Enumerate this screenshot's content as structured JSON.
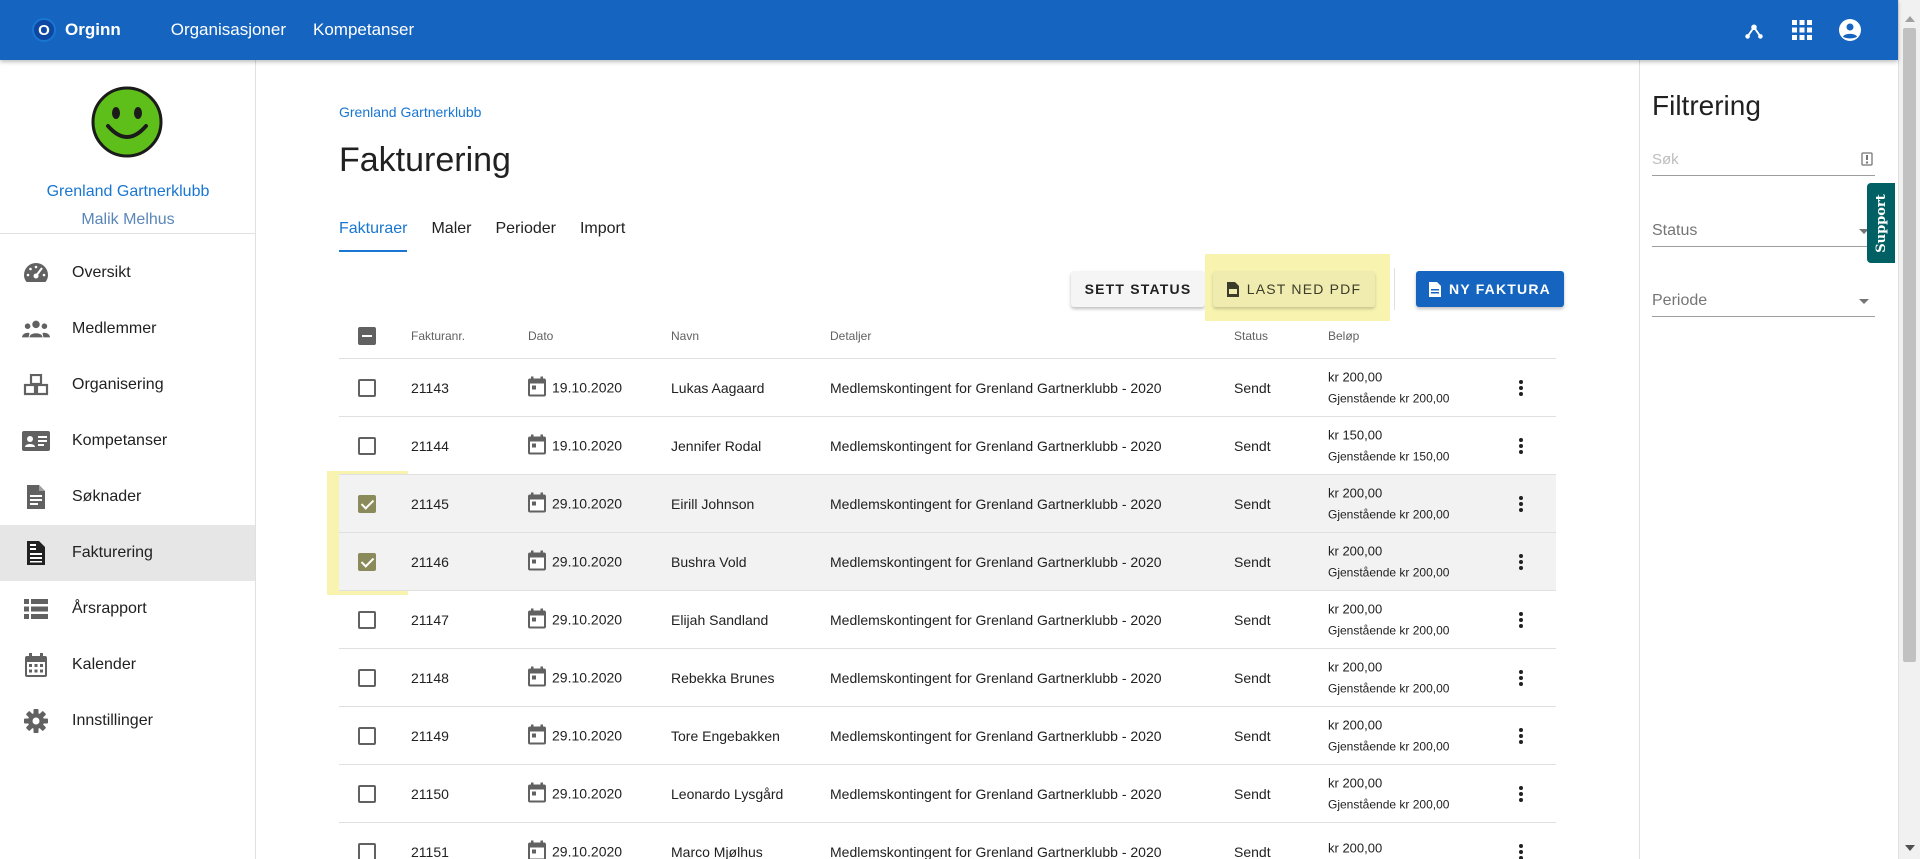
{
  "topbar": {
    "brand_letter": "O",
    "brand_name": "Orginn",
    "nav": [
      "Organisasjoner",
      "Kompetanser"
    ],
    "icons": [
      "hub-icon",
      "apps-grid-icon",
      "account-circle-icon"
    ]
  },
  "sidebar": {
    "org_name": "Grenland Gartnerklubb",
    "user_name": "Malik Melhus",
    "items": [
      {
        "label": "Oversikt",
        "icon": "speedometer-icon"
      },
      {
        "label": "Medlemmer",
        "icon": "group-icon"
      },
      {
        "label": "Organisering",
        "icon": "boxes-icon"
      },
      {
        "label": "Kompetanser",
        "icon": "id-card-icon"
      },
      {
        "label": "Søknader",
        "icon": "document-icon"
      },
      {
        "label": "Fakturering",
        "icon": "invoice-icon",
        "active": true
      },
      {
        "label": "Årsrapport",
        "icon": "list-icon"
      },
      {
        "label": "Kalender",
        "icon": "calendar-icon"
      },
      {
        "label": "Innstillinger",
        "icon": "gear-icon"
      }
    ]
  },
  "main": {
    "breadcrumb": "Grenland Gartnerklubb",
    "title": "Fakturering",
    "tabs": [
      "Fakturaer",
      "Maler",
      "Perioder",
      "Import"
    ],
    "active_tab": "Fakturaer",
    "buttons": {
      "set_status": "Sett status",
      "download_pdf": "Last ned PDF",
      "new_invoice": "Ny faktura"
    },
    "table": {
      "headers": {
        "nr": "Fakturanr.",
        "date": "Dato",
        "name": "Navn",
        "details": "Detaljer",
        "status": "Status",
        "amount": "Beløp"
      },
      "rows": [
        {
          "nr": "21143",
          "date": "19.10.2020",
          "name": "Lukas Aagaard",
          "details": "Medlemskontingent for Grenland Gartnerklubb - 2020",
          "status": "Sendt",
          "amount": "kr 200,00",
          "remaining": "Gjenstående kr 200,00",
          "checked": false
        },
        {
          "nr": "21144",
          "date": "19.10.2020",
          "name": "Jennifer Rodal",
          "details": "Medlemskontingent for Grenland Gartnerklubb - 2020",
          "status": "Sendt",
          "amount": "kr 150,00",
          "remaining": "Gjenstående kr 150,00",
          "checked": false
        },
        {
          "nr": "21145",
          "date": "29.10.2020",
          "name": "Eirill Johnson",
          "details": "Medlemskontingent for Grenland Gartnerklubb - 2020",
          "status": "Sendt",
          "amount": "kr 200,00",
          "remaining": "Gjenstående kr 200,00",
          "checked": true
        },
        {
          "nr": "21146",
          "date": "29.10.2020",
          "name": "Bushra Vold",
          "details": "Medlemskontingent for Grenland Gartnerklubb - 2020",
          "status": "Sendt",
          "amount": "kr 200,00",
          "remaining": "Gjenstående kr 200,00",
          "checked": true
        },
        {
          "nr": "21147",
          "date": "29.10.2020",
          "name": "Elijah Sandland",
          "details": "Medlemskontingent for Grenland Gartnerklubb - 2020",
          "status": "Sendt",
          "amount": "kr 200,00",
          "remaining": "Gjenstående kr 200,00",
          "checked": false
        },
        {
          "nr": "21148",
          "date": "29.10.2020",
          "name": "Rebekka Brunes",
          "details": "Medlemskontingent for Grenland Gartnerklubb - 2020",
          "status": "Sendt",
          "amount": "kr 200,00",
          "remaining": "Gjenstående kr 200,00",
          "checked": false
        },
        {
          "nr": "21149",
          "date": "29.10.2020",
          "name": "Tore Engebakken",
          "details": "Medlemskontingent for Grenland Gartnerklubb - 2020",
          "status": "Sendt",
          "amount": "kr 200,00",
          "remaining": "Gjenstående kr 200,00",
          "checked": false
        },
        {
          "nr": "21150",
          "date": "29.10.2020",
          "name": "Leonardo Lysgård",
          "details": "Medlemskontingent for Grenland Gartnerklubb - 2020",
          "status": "Sendt",
          "amount": "kr 200,00",
          "remaining": "Gjenstående kr 200,00",
          "checked": false
        },
        {
          "nr": "21151",
          "date": "29.10.2020",
          "name": "Marco Mjølhus",
          "details": "Medlemskontingent for Grenland Gartnerklubb - 2020",
          "status": "Sendt",
          "amount": "kr 200,00",
          "remaining": "",
          "checked": false
        }
      ]
    }
  },
  "filter": {
    "title": "Filtrering",
    "search_placeholder": "Søk",
    "status_label": "Status",
    "period_label": "Periode"
  },
  "support_label": "Support",
  "colors": {
    "primary": "#1565c0",
    "link": "#1976d2",
    "highlight": "#f8f4b0",
    "support": "#006064",
    "avatar": "#5fbf1a"
  }
}
